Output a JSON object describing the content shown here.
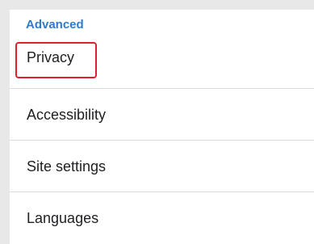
{
  "section": {
    "header": "Advanced"
  },
  "items": [
    {
      "label": "Privacy"
    },
    {
      "label": "Accessibility"
    },
    {
      "label": "Site settings"
    },
    {
      "label": "Languages"
    }
  ],
  "colors": {
    "accent": "#2d7bd0",
    "highlight": "#e0202a"
  }
}
